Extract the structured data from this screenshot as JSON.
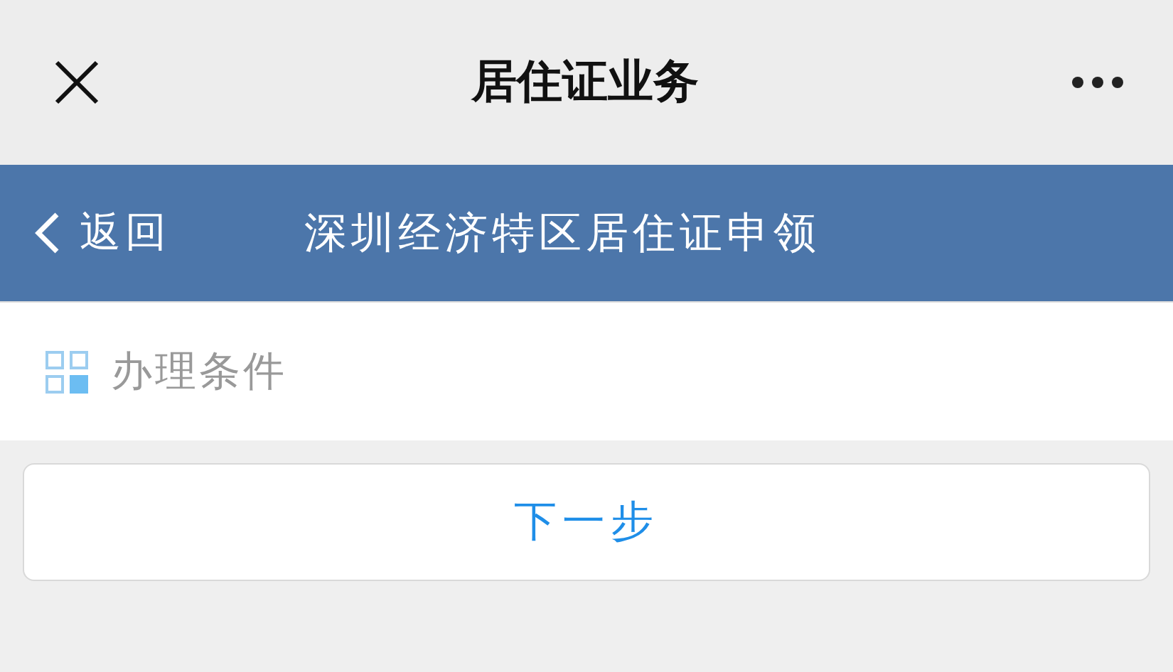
{
  "top_bar": {
    "title": "居住证业务"
  },
  "header": {
    "back_label": "返回",
    "title": "深圳经济特区居住证申领"
  },
  "section": {
    "label": "办理条件"
  },
  "buttons": [
    "下一步"
  ]
}
